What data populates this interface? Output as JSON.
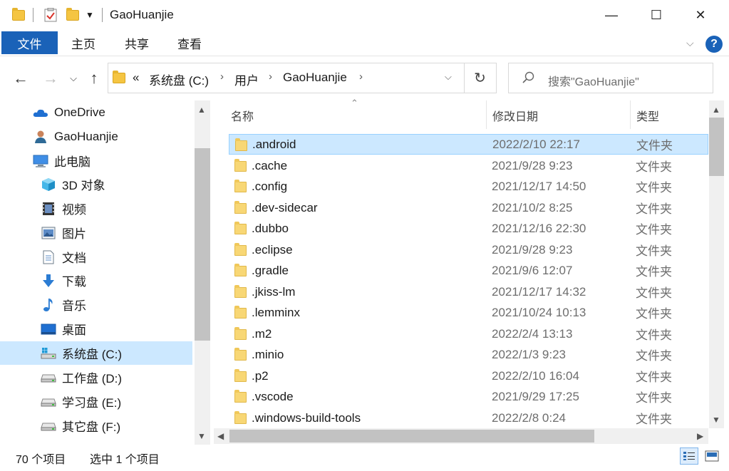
{
  "window": {
    "title": "GaoHuanjie",
    "minimize": "—",
    "maximize": "☐",
    "close": "✕"
  },
  "ribbon": {
    "tabs": [
      "文件",
      "主页",
      "共享",
      "查看"
    ]
  },
  "address": {
    "breadcrumbs": [
      "系统盘 (C:)",
      "用户",
      "GaoHuanjie"
    ],
    "overflow": "«",
    "search_placeholder": "搜索\"GaoHuanjie\""
  },
  "nav_pane": {
    "items": [
      {
        "label": "OneDrive",
        "icon": "cloud-icon",
        "level": 1
      },
      {
        "label": "GaoHuanjie",
        "icon": "user-icon",
        "level": 1
      },
      {
        "label": "此电脑",
        "icon": "computer-icon",
        "level": 1
      },
      {
        "label": "3D 对象",
        "icon": "cube-icon",
        "level": 2
      },
      {
        "label": "视频",
        "icon": "video-icon",
        "level": 2
      },
      {
        "label": "图片",
        "icon": "picture-icon",
        "level": 2
      },
      {
        "label": "文档",
        "icon": "document-icon",
        "level": 2
      },
      {
        "label": "下载",
        "icon": "download-icon",
        "level": 2
      },
      {
        "label": "音乐",
        "icon": "music-icon",
        "level": 2
      },
      {
        "label": "桌面",
        "icon": "desktop-icon",
        "level": 2
      },
      {
        "label": "系统盘 (C:)",
        "icon": "system-drive-icon",
        "level": 2,
        "selected": true
      },
      {
        "label": "工作盘 (D:)",
        "icon": "drive-icon",
        "level": 2
      },
      {
        "label": "学习盘 (E:)",
        "icon": "drive-icon",
        "level": 2
      },
      {
        "label": "其它盘 (F:)",
        "icon": "drive-icon",
        "level": 2
      }
    ]
  },
  "columns": {
    "name": "名称",
    "date": "修改日期",
    "type": "类型"
  },
  "files": [
    {
      "name": ".android",
      "date": "2022/2/10 22:17",
      "type": "文件夹",
      "selected": true
    },
    {
      "name": ".cache",
      "date": "2021/9/28 9:23",
      "type": "文件夹"
    },
    {
      "name": ".config",
      "date": "2021/12/17 14:50",
      "type": "文件夹"
    },
    {
      "name": ".dev-sidecar",
      "date": "2021/10/2 8:25",
      "type": "文件夹"
    },
    {
      "name": ".dubbo",
      "date": "2021/12/16 22:30",
      "type": "文件夹"
    },
    {
      "name": ".eclipse",
      "date": "2021/9/28 9:23",
      "type": "文件夹"
    },
    {
      "name": ".gradle",
      "date": "2021/9/6 12:07",
      "type": "文件夹"
    },
    {
      "name": ".jkiss-lm",
      "date": "2021/12/17 14:32",
      "type": "文件夹"
    },
    {
      "name": ".lemminx",
      "date": "2021/10/24 10:13",
      "type": "文件夹"
    },
    {
      "name": ".m2",
      "date": "2022/2/4 13:13",
      "type": "文件夹"
    },
    {
      "name": ".minio",
      "date": "2022/1/3 9:23",
      "type": "文件夹"
    },
    {
      "name": ".p2",
      "date": "2022/2/10 16:04",
      "type": "文件夹"
    },
    {
      "name": ".vscode",
      "date": "2021/9/29 17:25",
      "type": "文件夹"
    },
    {
      "name": ".windows-build-tools",
      "date": "2022/2/8 0:24",
      "type": "文件夹"
    }
  ],
  "status": {
    "item_count": "70 个项目",
    "selection": "选中 1 个项目"
  },
  "colors": {
    "accent": "#1a62b8",
    "selection": "#cce8ff",
    "folder": "#f8d775"
  }
}
